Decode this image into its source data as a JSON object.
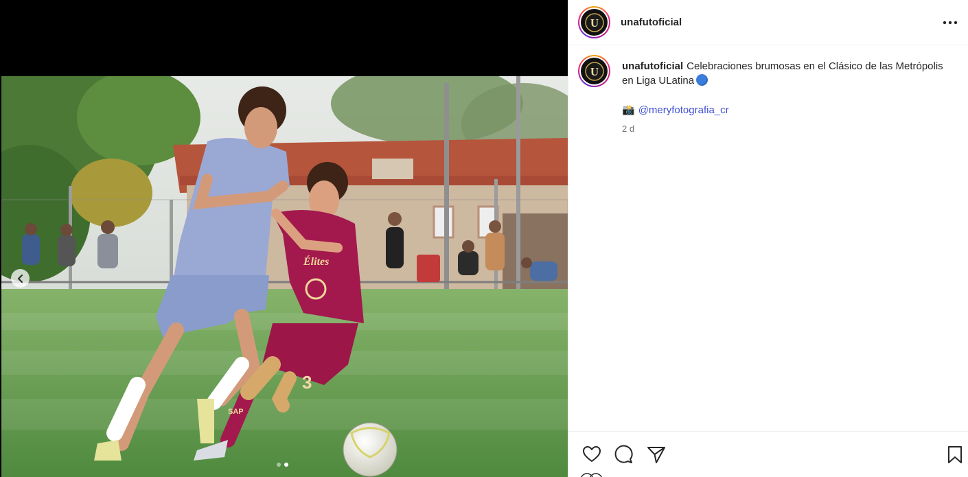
{
  "post": {
    "username": "unafutoficial",
    "avatar_letter": "U",
    "caption_text": "Celebraciones brumosas en el Clásico de las Metrópolis en Liga ULatina",
    "caption_emoji": "blue-circle",
    "credit_icon": "📸",
    "credit_mention": "@meryfotografia_cr",
    "timestamp": "2 d"
  },
  "media": {
    "slide_count": 2,
    "active_slide": 2,
    "ball_sponsor": "SAP",
    "player_number": "3",
    "jersey_text": "Élites"
  },
  "icons": {
    "more": "more-horizontal-icon",
    "prev": "chevron-left-icon",
    "like": "heart-icon",
    "comment": "comment-icon",
    "share": "share-icon",
    "save": "bookmark-icon"
  },
  "colors": {
    "accent": "#4150d0",
    "text": "#262626",
    "muted": "#737373",
    "home_kit": "#8e9fd0",
    "away_kit": "#a0174f"
  }
}
